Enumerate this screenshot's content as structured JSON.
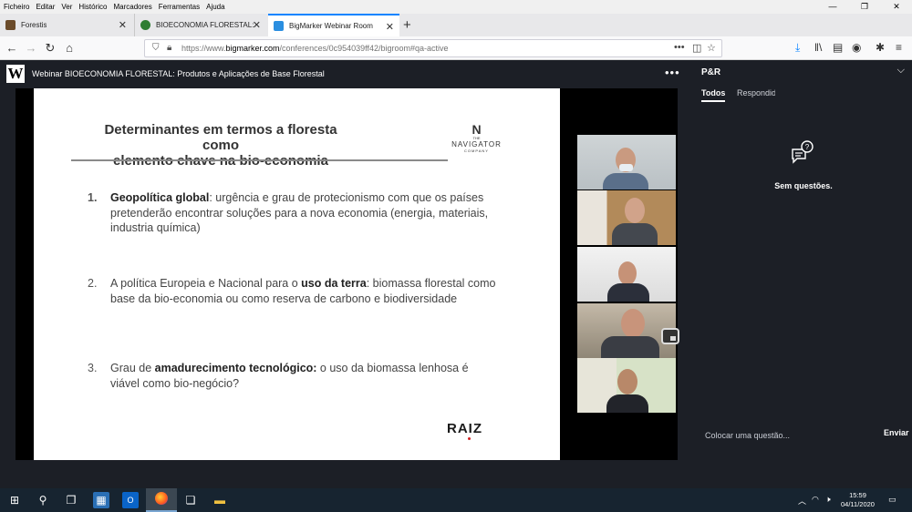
{
  "menubar": {
    "items": [
      "Ficheiro",
      "Editar",
      "Ver",
      "Histórico",
      "Marcadores",
      "Ferramentas",
      "Ajuda"
    ],
    "window_controls": [
      "—",
      "❐",
      "✕"
    ]
  },
  "tabs": [
    {
      "title": "Forestis",
      "close": "✕",
      "active": false
    },
    {
      "title": "BIOECONOMIA FLORESTAL: Pro",
      "close": "✕",
      "active": false
    },
    {
      "title": "BigMarker Webinar Room",
      "close": "✕",
      "active": true
    }
  ],
  "tab_new": "+",
  "address": {
    "prefix": "https://www.",
    "domain": "bigmarker.com",
    "rest": "/conferences/0c954039ff42/bigroom#qa-active"
  },
  "app": {
    "logo": "W",
    "webinar_title": "Webinar BIOECONOMIA FLORESTAL: Produtos e Aplicações de Base Florestal",
    "more": "•••"
  },
  "slide": {
    "title_line1": "Determinantes em termos a floresta como",
    "title_line2": "elemento chave na bio-economia",
    "logo_n": "N",
    "logo_the": "THE",
    "logo_navigator": "NAVIGATOR",
    "logo_company": "COMPANY",
    "items": [
      {
        "num": "1.",
        "bold": "Geopolítica global",
        "text": ": urgência e grau de protecionismo com que os países pretenderão encontrar soluções para a nova economia (energia, materiais, industria química)"
      },
      {
        "num": "2.",
        "pre": "A política Europeia e Nacional para o ",
        "bold": "uso da terra",
        "text": ": biomassa florestal como base da bio-economia ou como reserva de carbono e biodiversidade"
      },
      {
        "num": "3.",
        "pre": "Grau de ",
        "bold": "amadurecimento tecnológico:",
        "text": " o uso da biomassa lenhosa é viável como bio-negócio?"
      }
    ],
    "raiz": "RAIZ"
  },
  "qa": {
    "title": "P&R",
    "tab_all": "Todos",
    "tab_answered": "Respondidas",
    "empty": "Sem questões.",
    "input_placeholder": "Colocar uma questão...",
    "send": "Enviar"
  },
  "taskbar": {
    "time": "15:59",
    "date": "04/11/2020"
  },
  "colors": {
    "app_bg": "#1c1f26",
    "accent": "#0a84ff",
    "taskbar": "#172430"
  }
}
